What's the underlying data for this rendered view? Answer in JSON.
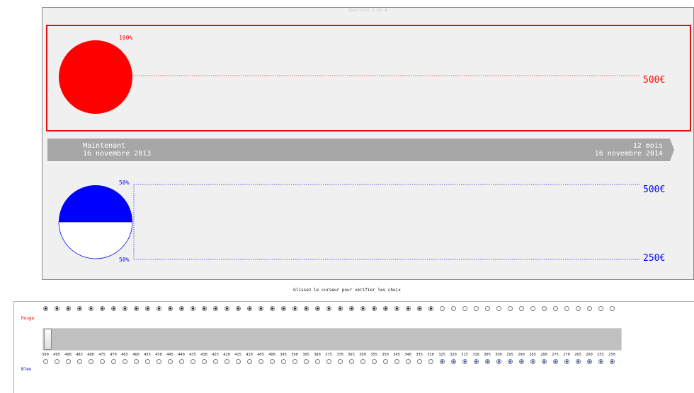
{
  "question_label": "Question 2 on 4",
  "red_option": {
    "percent": "100%",
    "amount": "500€",
    "probability": 1.0,
    "color": "#ff0000"
  },
  "timeline": {
    "now_label": "Maintenant",
    "now_date": "16 novembre 2013",
    "later_label": "12 mois",
    "later_date": "16 novembre 2014"
  },
  "blue_option": {
    "top_percent": "50%",
    "bottom_percent": "50%",
    "top_amount": "500€",
    "bottom_amount": "250€",
    "probability_top": 0.5,
    "color": "#0000ff"
  },
  "instruction": "Glissez le curseur pour vérifier les choix",
  "slider": {
    "rouge_label": "Rouge",
    "bleu_label": "Bleu",
    "values": [
      "500",
      "495",
      "490",
      "485",
      "480",
      "475",
      "470",
      "465",
      "460",
      "455",
      "450",
      "445",
      "440",
      "435",
      "430",
      "425",
      "420",
      "415",
      "410",
      "405",
      "400",
      "395",
      "390",
      "385",
      "380",
      "375",
      "370",
      "365",
      "360",
      "355",
      "350",
      "345",
      "340",
      "335",
      "330",
      "325",
      "320",
      "315",
      "310",
      "305",
      "300",
      "295",
      "290",
      "285",
      "280",
      "275",
      "270",
      "265",
      "260",
      "255",
      "250"
    ],
    "rouge_checked_count": 35,
    "position": 0
  }
}
